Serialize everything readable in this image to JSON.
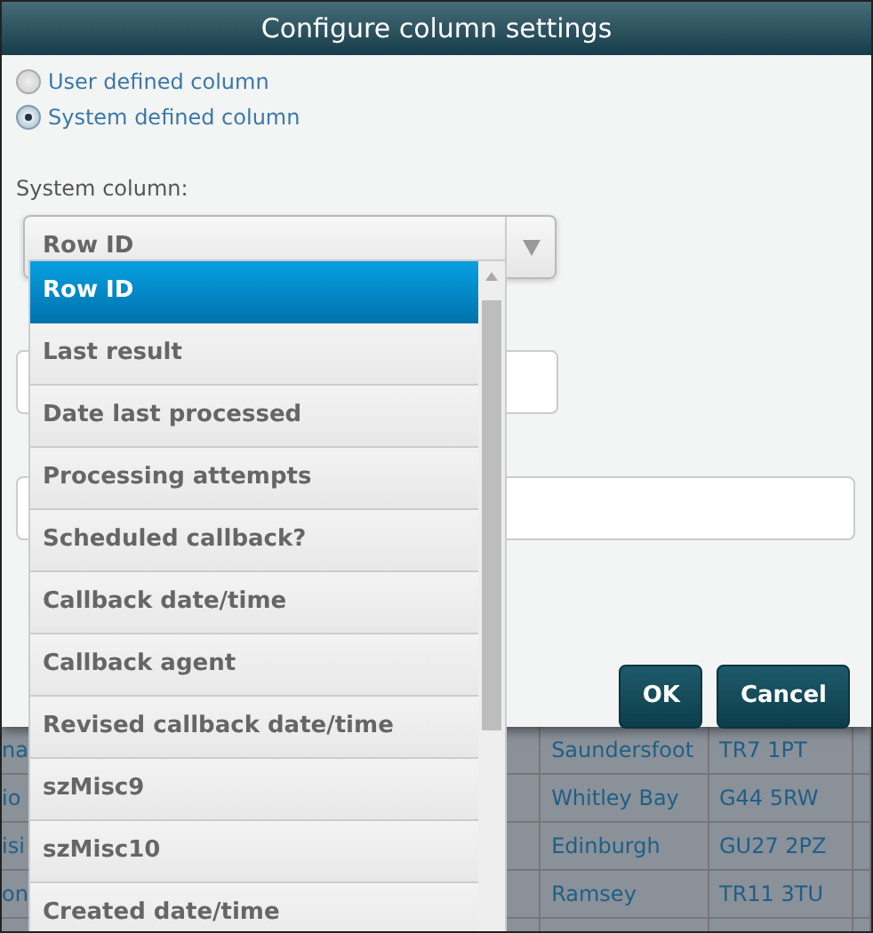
{
  "dialog": {
    "title": "Configure column settings",
    "column_type": [
      {
        "label": "User defined column",
        "selected": false
      },
      {
        "label": "System defined column",
        "selected": true
      }
    ],
    "system_column": {
      "label": "System column:",
      "value": "Row ID"
    },
    "dropdown_options": [
      {
        "label": "Row ID",
        "selected": true
      },
      {
        "label": "Last result",
        "selected": false
      },
      {
        "label": "Date last processed",
        "selected": false
      },
      {
        "label": "Processing attempts",
        "selected": false
      },
      {
        "label": "Scheduled callback?",
        "selected": false
      },
      {
        "label": "Callback date/time",
        "selected": false
      },
      {
        "label": "Callback agent",
        "selected": false
      },
      {
        "label": "Revised callback date/time",
        "selected": false
      },
      {
        "label": "szMisc9",
        "selected": false
      },
      {
        "label": "szMisc10",
        "selected": false
      },
      {
        "label": "Created date/time",
        "selected": false
      }
    ],
    "buttons": [
      "OK",
      "Cancel"
    ]
  },
  "background_table": {
    "rows": [
      [
        "na",
        "Saundersfoot",
        "TR7 1PT"
      ],
      [
        "io",
        "Whitley Bay",
        "G44 5RW"
      ],
      [
        "isi",
        "Edinburgh",
        "GU27 2PZ"
      ],
      [
        "on",
        "Ramsey",
        "TR11 3TU"
      ],
      [
        "",
        "",
        ""
      ]
    ]
  }
}
